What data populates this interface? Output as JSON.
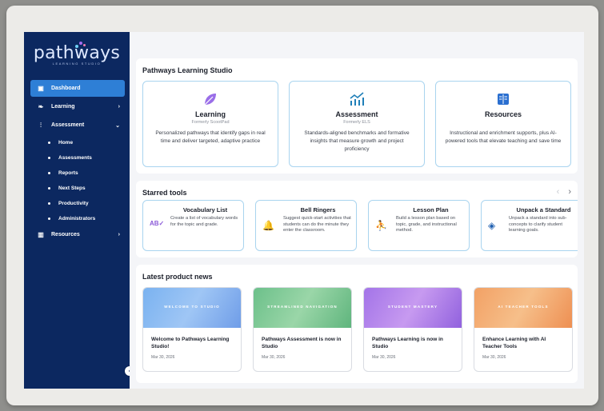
{
  "brand": {
    "name": "pathways",
    "tagline": "LEARNING STUDIO"
  },
  "sidebar": {
    "items": [
      {
        "label": "Dashboard",
        "icon": "dashboard-icon"
      },
      {
        "label": "Learning",
        "icon": "leaf-icon"
      },
      {
        "label": "Assessment",
        "icon": "chart-icon"
      },
      {
        "label": "Resources",
        "icon": "book-icon"
      }
    ],
    "assessment_sub": [
      "Home",
      "Assessments",
      "Reports",
      "Next Steps",
      "Productivity",
      "Administrators"
    ]
  },
  "studio": {
    "title": "Pathways Learning Studio",
    "cards": [
      {
        "title": "Learning",
        "sub": "Formerly ScootPad",
        "desc": "Personalized pathways that identify gaps in real time and deliver targeted, adaptive practice",
        "icon": "leaf-icon"
      },
      {
        "title": "Assessment",
        "sub": "Formerly ELS",
        "desc": "Standards-aligned benchmarks and formative insights that measure growth and project proficiency",
        "icon": "chart-icon"
      },
      {
        "title": "Resources",
        "sub": "",
        "desc": "Instructional and enrichment supports, plus AI-powered tools that elevate teaching and save time",
        "icon": "book-icon"
      }
    ]
  },
  "starred": {
    "title": "Starred tools",
    "prev": "‹",
    "next": "›",
    "tools": [
      {
        "title": "Vocabulary List",
        "desc": "Create a list of vocabulary words for the topic and grade.",
        "icon": "vocabulary-icon"
      },
      {
        "title": "Bell Ringers",
        "desc": "Suggest quick-start activities that students can do the minute they enter the classroom.",
        "icon": "bell-icon"
      },
      {
        "title": "Lesson Plan",
        "desc": "Build a lesson plan based on topic, grade, and instructional method.",
        "icon": "teacher-icon"
      },
      {
        "title": "Unpack a Standard",
        "desc": "Unpack a standard into sub-concepts to clarify student learning goals.",
        "icon": "box-icon"
      }
    ]
  },
  "news": {
    "title": "Latest product news",
    "items": [
      {
        "banner": "WELCOME TO STUDIO",
        "title": "Welcome to Pathways Learning Studio!",
        "date": "Mar 30, 2026"
      },
      {
        "banner": "STREAMLINED NAVIGATION",
        "title": "Pathways Assessment is now in Studio",
        "date": "Mar 30, 2026"
      },
      {
        "banner": "STUDENT MASTERY",
        "title": "Pathways Learning is now in Studio",
        "date": "Mar 30, 2026"
      },
      {
        "banner": "AI TEACHER TOOLS",
        "title": "Enhance Learning with AI Teacher Tools",
        "date": "Mar 30, 2026"
      }
    ]
  },
  "colors": {
    "sidebar": "#0c2860",
    "accent": "#2e7fd6",
    "card_border": "#a9d4ef"
  }
}
